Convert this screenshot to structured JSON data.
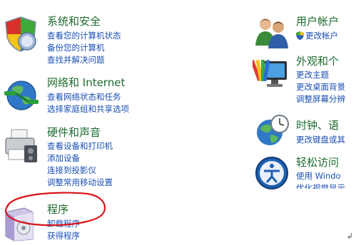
{
  "left_column": [
    {
      "title": "系统和安全",
      "icon": "shield-icon",
      "links": [
        "查看您的计算机状态",
        "备份您的计算机",
        "查找并解决问题"
      ]
    },
    {
      "title": "网络和 Internet",
      "icon": "network-globe-icon",
      "links": [
        "查看网络状态和任务",
        "选择家庭组和共享选项"
      ]
    },
    {
      "title": "硬件和声音",
      "icon": "printer-icon",
      "links": [
        "查看设备和打印机",
        "添加设备",
        "连接到投影仪",
        "调整常用移动设置"
      ]
    },
    {
      "title": "程序",
      "icon": "programs-box-icon",
      "links": [
        "卸载程序",
        "获得程序"
      ]
    }
  ],
  "right_column": [
    {
      "title": "用户帐户",
      "icon": "users-icon",
      "links": [
        "更改帐户"
      ]
    },
    {
      "title": "外观和个",
      "icon": "appearance-monitor-icon",
      "links": [
        "更改主题",
        "更改桌面背景",
        "调整屏幕分辨"
      ]
    },
    {
      "title": "时钟、语",
      "icon": "clock-globe-icon",
      "links": [
        "更改键盘或其"
      ]
    },
    {
      "title": "轻松访问",
      "icon": "ease-of-access-icon",
      "links": [
        "使用 Windo",
        "优化视觉显示"
      ]
    }
  ],
  "highlight_color": "#d8141c",
  "title_color": "#1e6b2f",
  "link_color": "#1a4fb3"
}
